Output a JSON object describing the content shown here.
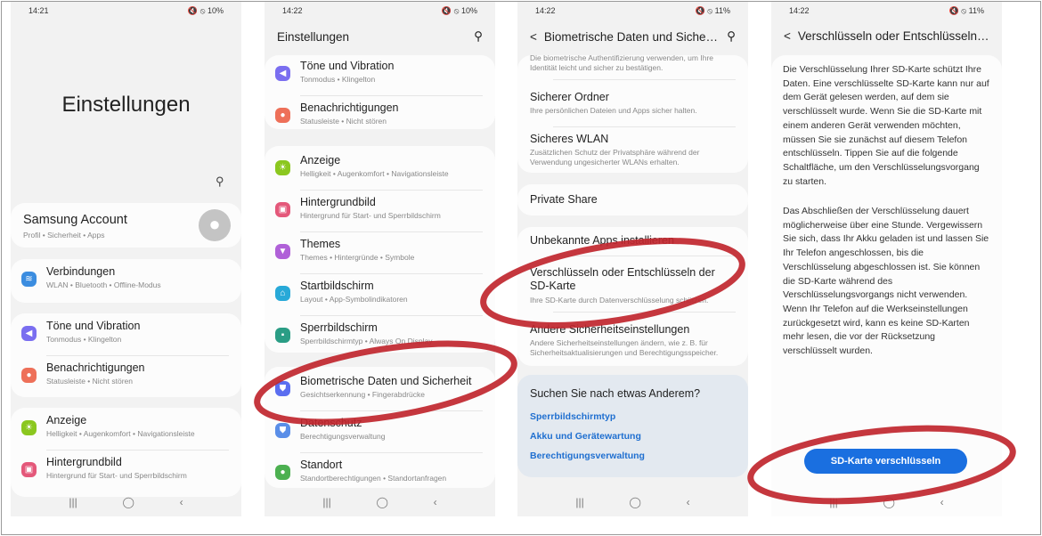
{
  "colors": {
    "accent": "#1a6fe0",
    "annotation": "#c0262e",
    "background": "#f2f2f2"
  },
  "p1": {
    "time": "14:21",
    "status": "🔇 ⦸ 10%",
    "title": "Einstellungen",
    "account": {
      "title": "Samsung Account",
      "sub": "Profil • Sicherheit • Apps"
    },
    "items": [
      {
        "title": "Verbindungen",
        "sub": "WLAN • Bluetooth • Offline-Modus",
        "icon": "wifi-icon",
        "color": "#3b8de0"
      },
      {
        "title": "Töne und Vibration",
        "sub": "Tonmodus • Klingelton",
        "icon": "sound-icon",
        "color": "#7a6ef0"
      },
      {
        "title": "Benachrichtigungen",
        "sub": "Statusleiste • Nicht stören",
        "icon": "notification-icon",
        "color": "#ee7059"
      },
      {
        "title": "Anzeige",
        "sub": "Helligkeit • Augenkomfort • Navigationsleiste",
        "icon": "display-icon",
        "color": "#8bc71f"
      },
      {
        "title": "Hintergrundbild",
        "sub": "Hintergrund für Start- und Sperrbildschirm",
        "icon": "wallpaper-icon",
        "color": "#e4587a"
      }
    ]
  },
  "p2": {
    "time": "14:22",
    "status": "🔇 ⦸ 10%",
    "title": "Einstellungen",
    "items": [
      {
        "title": "Töne und Vibration",
        "sub": "Tonmodus • Klingelton",
        "color": "#7a6ef0"
      },
      {
        "title": "Benachrichtigungen",
        "sub": "Statusleiste • Nicht stören",
        "color": "#ee7059"
      },
      {
        "title": "Anzeige",
        "sub": "Helligkeit • Augenkomfort • Navigationsleiste",
        "color": "#8bc71f"
      },
      {
        "title": "Hintergrundbild",
        "sub": "Hintergrund für Start- und Sperrbildschirm",
        "color": "#e4587a"
      },
      {
        "title": "Themes",
        "sub": "Themes • Hintergründe • Symbole",
        "color": "#b061d8"
      },
      {
        "title": "Startbildschirm",
        "sub": "Layout • App-Symbolindikatoren",
        "color": "#28a9d8"
      },
      {
        "title": "Sperrbildschirm",
        "sub": "Sperrbildschirmtyp • Always On Display",
        "color": "#2a9d85"
      },
      {
        "title": "Biometrische Daten und Sicherheit",
        "sub": "Gesichtserkennung • Fingerabdrücke",
        "color": "#5b6ef0"
      },
      {
        "title": "Datenschutz",
        "sub": "Berechtigungsverwaltung",
        "color": "#5a8ee8"
      },
      {
        "title": "Standort",
        "sub": "Standortberechtigungen • Standortanfragen",
        "color": "#4cb050"
      }
    ]
  },
  "p3": {
    "time": "14:22",
    "status": "🔇 ⦸ 11%",
    "title": "Biometrische Daten und Sicherh...",
    "top_desc": "Die biometrische Authentifizierung verwenden, um Ihre Identität leicht und sicher zu bestätigen.",
    "items": [
      {
        "title": "Sicherer Ordner",
        "sub": "Ihre persönlichen Dateien und Apps sicher halten."
      },
      {
        "title": "Sicheres WLAN",
        "sub": "Zusätzlichen Schutz der Privatsphäre während der Verwendung ungesicherter WLANs erhalten."
      },
      {
        "title": "Private Share",
        "sub": ""
      },
      {
        "title": "Unbekannte Apps installieren",
        "sub": ""
      },
      {
        "title": "Verschlüsseln oder Entschlüsseln der SD-Karte",
        "sub": "Ihre SD-Karte durch Datenverschlüsselung schützen."
      },
      {
        "title": "Andere Sicherheitseinstellungen",
        "sub": "Andere Sicherheitseinstellungen ändern, wie z. B. für Sicherheitsaktualisierungen und Berechtigungsspeicher."
      }
    ],
    "suggest": {
      "title": "Suchen Sie nach etwas Anderem?",
      "links": [
        "Sperrbildschirmtyp",
        "Akku und Gerätewartung",
        "Berechtigungsverwaltung"
      ]
    }
  },
  "p4": {
    "time": "14:22",
    "status": "🔇 ⦸ 11%",
    "title": "Verschlüsseln oder Entschlüsseln der...",
    "para1": "Die Verschlüsselung Ihrer SD-Karte schützt Ihre Daten. Eine verschlüsselte SD-Karte kann nur auf dem Gerät gelesen werden, auf dem sie verschlüsselt wurde. Wenn Sie die SD-Karte mit einem anderen Gerät verwenden möchten, müssen Sie sie zunächst auf diesem Telefon entschlüsseln. Tippen Sie auf die folgende Schaltfläche, um den Verschlüsselungsvorgang zu starten.",
    "para2": "Das Abschließen der Verschlüsselung dauert möglicherweise über eine Stunde. Vergewissern Sie sich, dass Ihr Akku geladen ist und lassen Sie Ihr Telefon angeschlossen, bis die Verschlüsselung abgeschlossen ist. Sie können die SD-Karte während des Verschlüsselungsvorgangs nicht verwenden. Wenn Ihr Telefon auf die Werkseinstellungen zurückgesetzt wird, kann es keine SD-Karten mehr lesen, die vor der Rücksetzung verschlüsselt wurden.",
    "button": "SD-Karte verschlüsseln"
  },
  "nav": {
    "recents": "|||",
    "home": "◯",
    "back": "‹"
  }
}
